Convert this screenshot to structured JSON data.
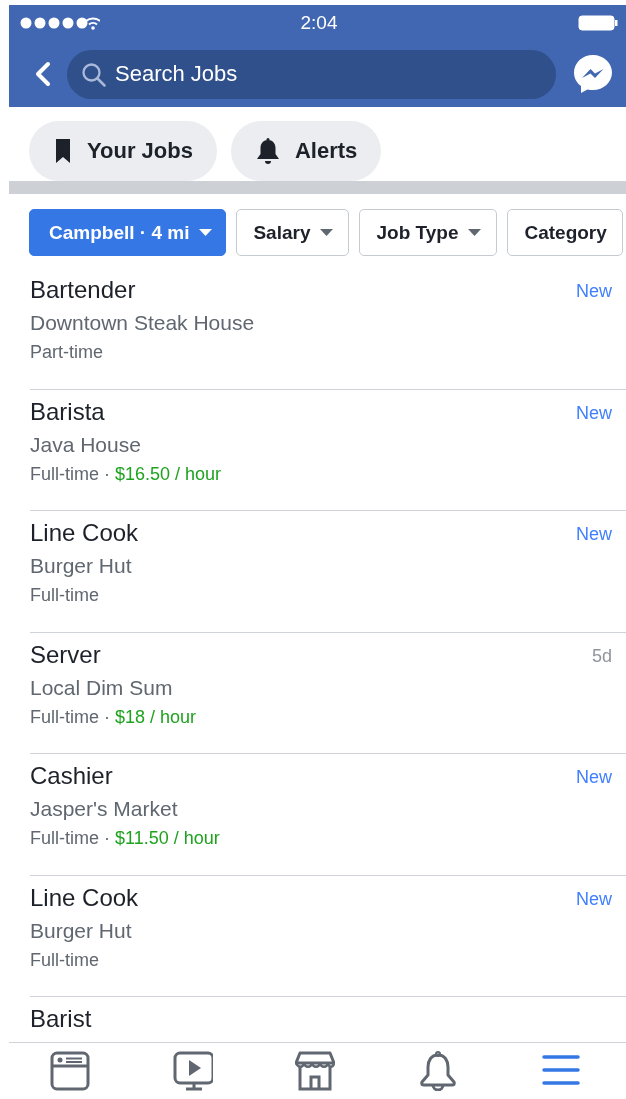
{
  "status_bar": {
    "time": "2:04"
  },
  "search": {
    "placeholder": "Search Jobs"
  },
  "shortcuts": [
    {
      "label": "Your Jobs",
      "kind": "bookmark"
    },
    {
      "label": "Alerts",
      "kind": "bell"
    }
  ],
  "filters": [
    {
      "label": "Campbell · 4 mi",
      "selected": true,
      "dropdown": true
    },
    {
      "label": "Salary",
      "selected": false,
      "dropdown": true
    },
    {
      "label": "Job Type",
      "selected": false,
      "dropdown": true
    },
    {
      "label": "Category",
      "selected": false,
      "dropdown": false
    }
  ],
  "jobs": [
    {
      "title": "Bartender",
      "company": "Downtown Steak House",
      "type": "Part-time",
      "badge": "New",
      "is_new": true
    },
    {
      "title": "Barista",
      "company": "Java House",
      "type": "Full-time",
      "separator": "·",
      "pay": "$16.50 / hour",
      "badge": "New",
      "is_new": true
    },
    {
      "title": "Line Cook",
      "company": "Burger Hut",
      "type": "Full-time",
      "badge": "New",
      "is_new": true
    },
    {
      "title": "Server",
      "company": "Local Dim Sum",
      "type": "Full-time",
      "separator": "·",
      "pay": "$18 / hour",
      "badge": "5d",
      "is_new": false
    },
    {
      "title": "Cashier",
      "company": "Jasper's Market",
      "type": "Full-time",
      "separator": "·",
      "pay": "$11.50 / hour",
      "badge": "New",
      "is_new": true
    },
    {
      "title": "Line Cook",
      "company": "Burger Hut",
      "type": "Full-time",
      "badge": "New",
      "is_new": true
    },
    {
      "title": "Barist"
    }
  ],
  "tabs": [
    {
      "kind": "news",
      "selected": false
    },
    {
      "kind": "video",
      "selected": false
    },
    {
      "kind": "store",
      "selected": false
    },
    {
      "kind": "bell",
      "selected": false
    },
    {
      "kind": "menu",
      "selected": true
    }
  ]
}
